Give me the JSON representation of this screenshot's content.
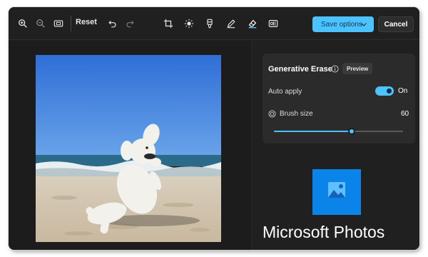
{
  "toolbar": {
    "left_icons": [
      "zoom-in-icon",
      "zoom-out-icon",
      "fit-to-window-icon"
    ],
    "reset_label": "Reset",
    "history_icons": [
      "undo-icon",
      "redo-icon"
    ],
    "tools": [
      "crop-icon",
      "adjust-brightness-icon",
      "filter-icon",
      "markup-pen-icon",
      "generative-erase-icon",
      "background-icon"
    ],
    "active_tool": "generative-erase-icon",
    "save_label": "Save options",
    "cancel_label": "Cancel"
  },
  "panel": {
    "title": "Generative Erase",
    "preview_badge": "Preview",
    "auto_apply_label": "Auto apply",
    "auto_apply_state": "On",
    "auto_apply_on": true,
    "brush_label": "Brush size",
    "brush_value": "60",
    "brush_fraction": 0.6
  },
  "brand": {
    "name": "Microsoft Photos"
  },
  "colors": {
    "accent": "#4cc2ff",
    "background": "#1f1f1f",
    "panel": "#2b2b2b"
  }
}
